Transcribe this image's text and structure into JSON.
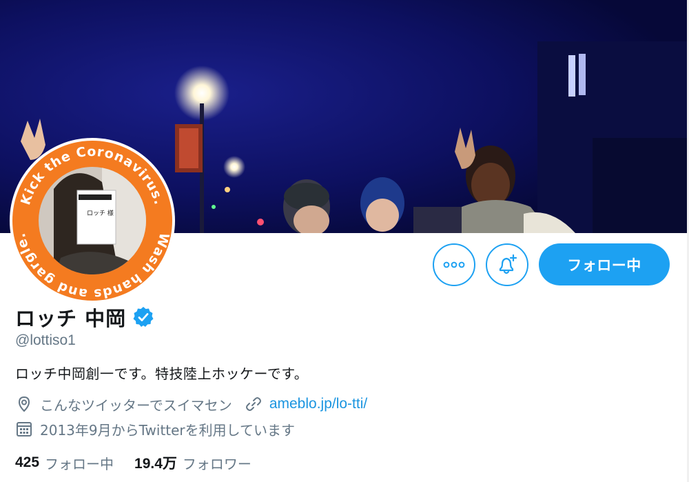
{
  "profile": {
    "display_name": "ロッチ 中岡",
    "handle": "@lottiso1",
    "bio": "ロッチ中岡創一です。特技陸上ホッケーです。",
    "location": "こんなツイッターでスイマセン",
    "website": "ameblo.jp/lo-tti/",
    "joined": "2013年9月からTwitterを利用しています",
    "verified": true
  },
  "avatar": {
    "ring_text": "Kick the Coronavirus. Wash hands and gargle.",
    "sign_text": "ロッチ 様",
    "ring_color": "#f47b20"
  },
  "actions": {
    "more_icon": "more-icon",
    "bell_icon": "notification-bell-plus-icon",
    "follow_label": "フォロー中"
  },
  "stats": [
    {
      "count": "425",
      "label": "フォロー中"
    },
    {
      "count": "19.4万",
      "label": "フォロワー"
    }
  ],
  "colors": {
    "accent": "#1da1f2",
    "link": "#1b95e0",
    "secondary_text": "#657786",
    "primary_text": "#14171a",
    "banner_bg": "#0b0f4a"
  },
  "icons": {
    "location": "location-pin-icon",
    "link": "link-icon",
    "calendar": "calendar-icon",
    "verified": "verified-badge-icon"
  }
}
